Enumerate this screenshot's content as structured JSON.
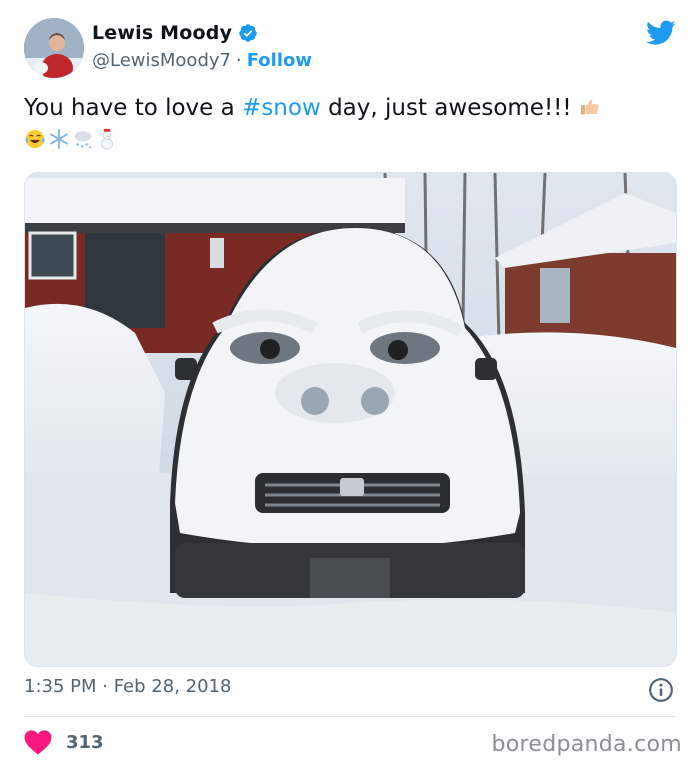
{
  "author": {
    "name": "Lewis Moody",
    "handle": "@LewisMoody7",
    "separator": "·",
    "follow_label": "Follow"
  },
  "tweet": {
    "text_before": "You have to love a ",
    "hashtag": "#snow",
    "text_after": " day, just awesome!!!",
    "emojis": [
      "thumbs-up-light-skin",
      "face-with-tears-of-joy",
      "snowflake",
      "cloud-with-snow",
      "snowman-with-snow"
    ]
  },
  "timestamp": "1:35 PM · Feb 28, 2018",
  "likes": {
    "count": "313"
  },
  "watermark": "boredpanda.com",
  "colors": {
    "accent": "#1d9bf0",
    "heart": "#f91880",
    "text": "#0f1419",
    "muted": "#536471"
  },
  "icons": {
    "verified": "verified-badge-icon",
    "brand": "twitter-bird-icon",
    "info": "info-icon",
    "like": "heart-icon"
  }
}
